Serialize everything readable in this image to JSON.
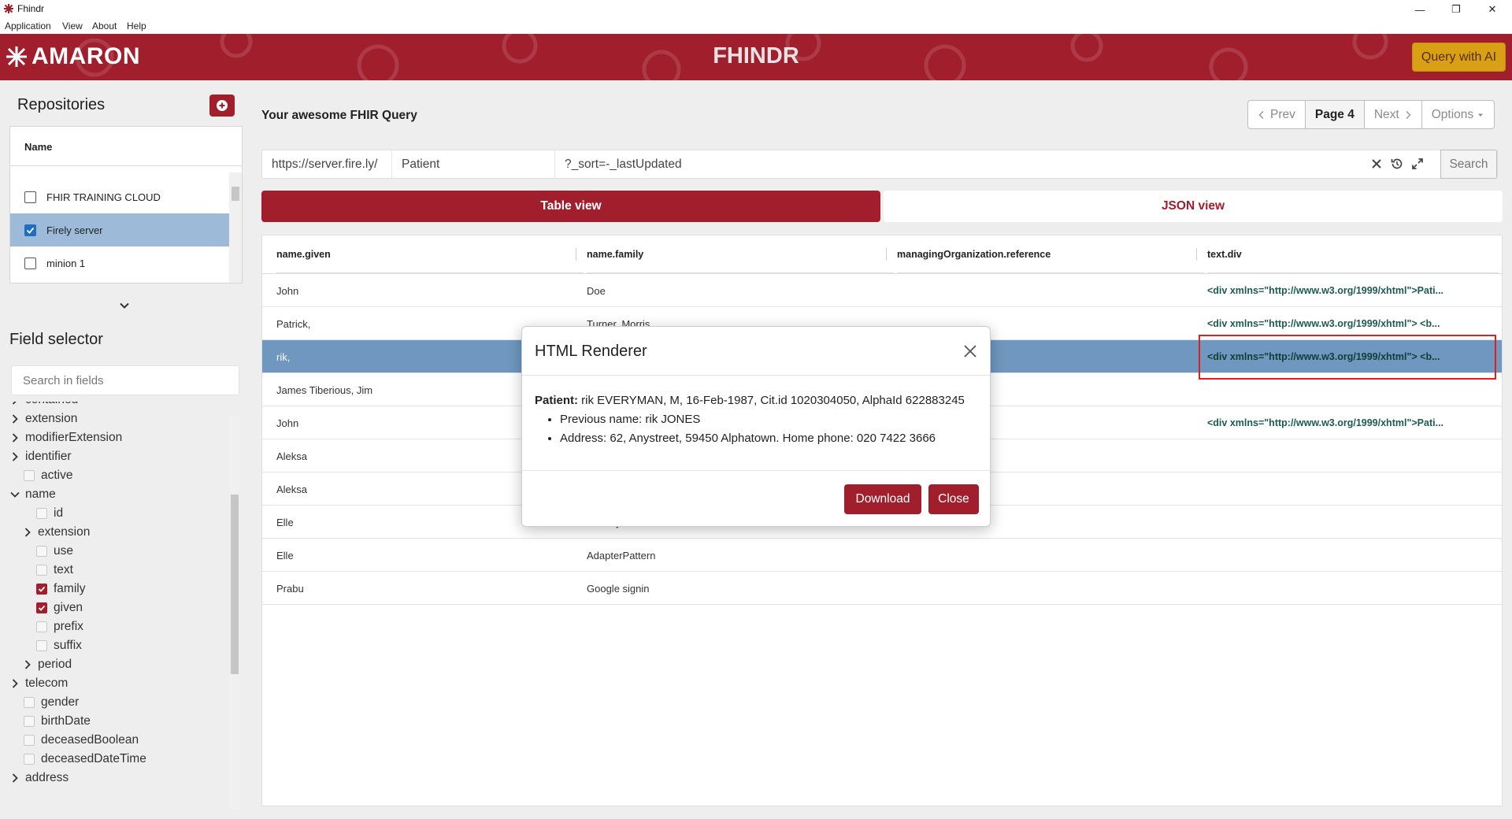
{
  "window": {
    "title": "Fhindr",
    "minimize": "—",
    "maximize": "❐",
    "close": "✕"
  },
  "menu": [
    "Application",
    "View",
    "About",
    "Help"
  ],
  "header": {
    "logo": "AMARON",
    "app_title": "FHINDR",
    "ai_button": "Query with AI"
  },
  "repositories": {
    "title": "Repositories",
    "column": "Name",
    "items": [
      {
        "label": "FHIR TRAINING CLOUD",
        "checked": false
      },
      {
        "label": "Firely server",
        "checked": true
      },
      {
        "label": "minion 1",
        "checked": false
      }
    ]
  },
  "field_selector": {
    "title": "Field selector",
    "search_placeholder": "Search in fields",
    "tree": [
      {
        "label": "contained",
        "kind": "chevron",
        "level": 0
      },
      {
        "label": "extension",
        "kind": "chevron",
        "level": 0
      },
      {
        "label": "modifierExtension",
        "kind": "chevron",
        "level": 0
      },
      {
        "label": "identifier",
        "kind": "chevron",
        "level": 0
      },
      {
        "label": "active",
        "kind": "check",
        "level": 0,
        "checked": false
      },
      {
        "label": "name",
        "kind": "open",
        "level": 0
      },
      {
        "label": "id",
        "kind": "check",
        "level": 1,
        "checked": false
      },
      {
        "label": "extension",
        "kind": "chevron",
        "level": 1
      },
      {
        "label": "use",
        "kind": "check",
        "level": 1,
        "checked": false
      },
      {
        "label": "text",
        "kind": "check",
        "level": 1,
        "checked": false
      },
      {
        "label": "family",
        "kind": "check",
        "level": 1,
        "checked": true
      },
      {
        "label": "given",
        "kind": "check",
        "level": 1,
        "checked": true
      },
      {
        "label": "prefix",
        "kind": "check",
        "level": 1,
        "checked": false
      },
      {
        "label": "suffix",
        "kind": "check",
        "level": 1,
        "checked": false
      },
      {
        "label": "period",
        "kind": "chevron",
        "level": 1
      },
      {
        "label": "telecom",
        "kind": "chevron",
        "level": 0
      },
      {
        "label": "gender",
        "kind": "check",
        "level": 0,
        "checked": false
      },
      {
        "label": "birthDate",
        "kind": "check",
        "level": 0,
        "checked": false
      },
      {
        "label": "deceasedBoolean",
        "kind": "check",
        "level": 0,
        "checked": false
      },
      {
        "label": "deceasedDateTime",
        "kind": "check",
        "level": 0,
        "checked": false
      },
      {
        "label": "address",
        "kind": "chevron",
        "level": 0
      }
    ]
  },
  "query": {
    "title": "Your awesome FHIR Query",
    "pager": {
      "prev": "Prev",
      "page": "Page 4",
      "next": "Next",
      "options": "Options"
    },
    "server": "https://server.fire.ly/",
    "resource": "Patient",
    "params": "?_sort=-_lastUpdated",
    "search_button": "Search"
  },
  "tabs": {
    "table": "Table view",
    "json": "JSON view"
  },
  "table": {
    "columns": [
      "name.given",
      "name.family",
      "managingOrganization.reference",
      "text.div"
    ],
    "rows": [
      [
        "John",
        "Doe",
        "",
        "<div xmlns=\"http://www.w3.org/1999/xhtml\">Pati..."
      ],
      [
        "Patrick,",
        "Turner, Morris",
        "",
        "<div xmlns=\"http://www.w3.org/1999/xhtml\"> <b..."
      ],
      [
        "rik,",
        "",
        "",
        "<div xmlns=\"http://www.w3.org/1999/xhtml\"> <b..."
      ],
      [
        "James Tiberious, Jim",
        "",
        "",
        ""
      ],
      [
        "John",
        "",
        "",
        "<div xmlns=\"http://www.w3.org/1999/xhtml\">Pati..."
      ],
      [
        "Aleksa",
        "",
        "",
        ""
      ],
      [
        "Aleksa",
        "",
        "",
        ""
      ],
      [
        "Elle",
        "FactoryPattern",
        "",
        ""
      ],
      [
        "Elle",
        "AdapterPattern",
        "",
        ""
      ],
      [
        "Prabu",
        "Google signin",
        "",
        ""
      ]
    ],
    "selected_row": 2
  },
  "modal": {
    "title": "HTML Renderer",
    "patient_label": "Patient:",
    "patient_text": " rik EVERYMAN, M, 16-Feb-1987, Cit.id 1020304050, AlphaId 622883245",
    "bullets": [
      "Previous name: rik JONES",
      "Address: 62, Anystreet, 59450 Alphatown. Home phone: 020 7422 3666"
    ],
    "download": "Download",
    "close": "Close"
  },
  "colors": {
    "brand": "#a11e2d",
    "ai_button": "#d8a014",
    "selection": "#6f97bf",
    "highlight_box": "#e02020"
  }
}
